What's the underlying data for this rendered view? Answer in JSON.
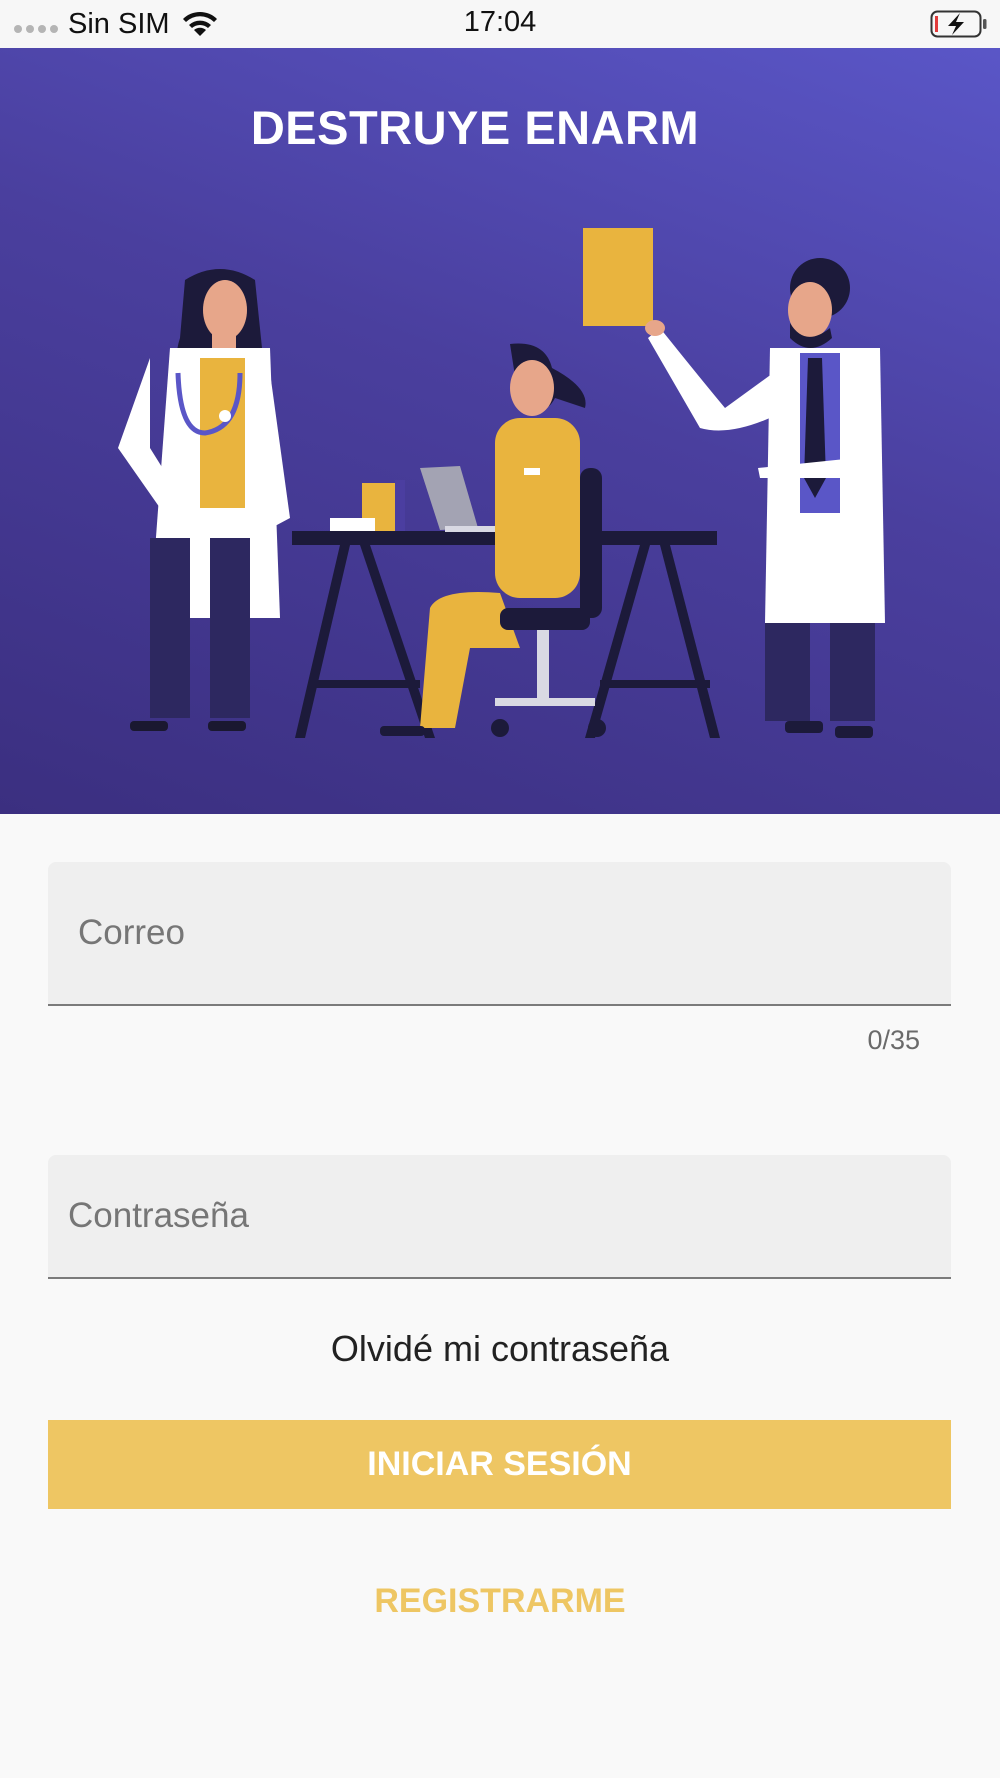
{
  "status_bar": {
    "carrier": "Sin SIM",
    "time": "17:04"
  },
  "hero": {
    "title": "DESTRUYE ENARM",
    "illustration": "doctors-illustration"
  },
  "form": {
    "email_placeholder": "Correo",
    "email_value": "",
    "email_counter": "0/35",
    "password_placeholder": "Contraseña",
    "password_value": "",
    "forgot_password": "Olvidé mi contraseña",
    "login_button": "INICIAR SESIÓN",
    "register_link": "REGISTRARME"
  },
  "colors": {
    "hero_gradient_start": "#5a56c7",
    "hero_gradient_end": "#3b2f80",
    "accent_yellow": "#eec663",
    "background": "#f9f9f9",
    "field_background": "#efefef"
  }
}
